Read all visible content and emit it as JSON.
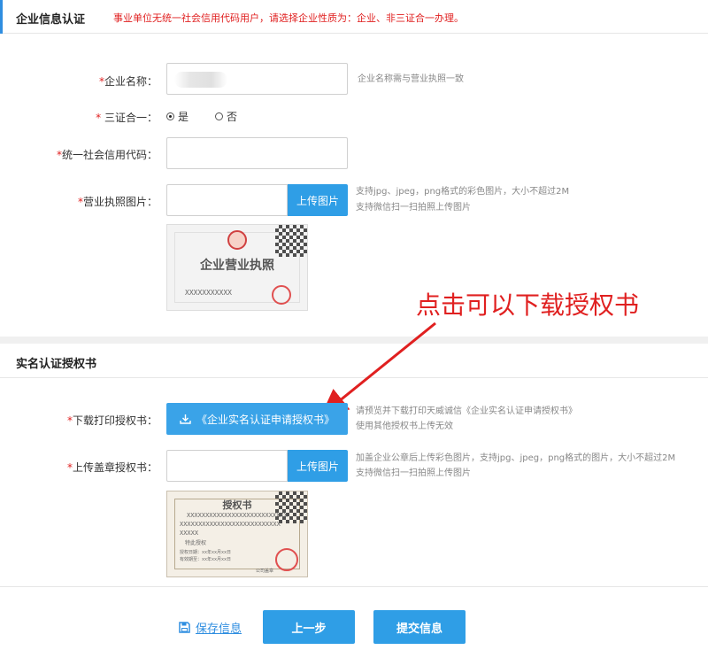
{
  "section1": {
    "title": "企业信息认证",
    "notice": "事业单位无统一社会信用代码用户，请选择企业性质为：企业、非三证合一办理。"
  },
  "form1": {
    "company_name": {
      "label": "企业名称：",
      "hint": "企业名称需与营业执照一致"
    },
    "three_in_one": {
      "label": "三证合一：",
      "options": [
        "是",
        "否"
      ],
      "selected": "是"
    },
    "credit_code": {
      "label": "统一社会信用代码：",
      "value": ""
    },
    "license_image": {
      "label": "营业执照图片：",
      "button": "上传图片",
      "hint_line1": "支持jpg、jpeg，png格式的彩色图片，大小不超过2M",
      "hint_line2": "支持微信扫一扫拍照上传图片"
    },
    "license_sample": {
      "title": "企业营业执照",
      "code": "XXXXXXXXXXX"
    }
  },
  "section2": {
    "title": "实名认证授权书"
  },
  "form2": {
    "download": {
      "label": "下载打印授权书：",
      "button": "《企业实名认证申请授权书》",
      "hint_line1": "请预览并下载打印天威诚信《企业实名认证申请授权书》",
      "hint_line2": "使用其他授权书上传无效"
    },
    "upload": {
      "label": "上传盖章授权书：",
      "button": "上传图片",
      "hint_line1": "加盖企业公章后上传彩色图片，支持jpg、jpeg，png格式的图片，大小不超过2M",
      "hint_line2": "支持微信扫一扫拍照上传图片"
    },
    "auth_sample": {
      "title": "授权书",
      "line1": "XXXXXXXXXXXXXXXXXXXXXXXXXXX",
      "line2": "XXXXXXXXXXXXXXXXXXXXXXXXXXX",
      "line3": "XXXXX",
      "line4": "特此授权",
      "line5": "授权日期：xx年xx月xx日",
      "line6": "有效期至：xx年xx月xx日",
      "stamp": "公司盖章"
    }
  },
  "annotation": "点击可以下载授权书",
  "footer": {
    "save": "保存信息",
    "prev": "上一步",
    "submit": "提交信息"
  },
  "colors": {
    "accent": "#2f9ee6",
    "required": "#e02020",
    "annotation": "#e02020"
  }
}
